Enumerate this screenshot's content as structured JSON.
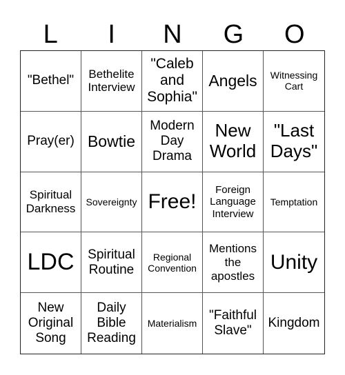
{
  "header": {
    "letters": [
      "L",
      "I",
      "N",
      "G",
      "O"
    ]
  },
  "board": {
    "rows": [
      [
        "\"Bethel\"",
        "Bethelite Interview",
        "\"Caleb and Sophia\"",
        "Angels",
        "Witnessing Cart"
      ],
      [
        "Pray(er)",
        "Bowtie",
        "Modern Day Drama",
        "New World",
        "\"Last Days\""
      ],
      [
        "Spiritual Darkness",
        "Sovereignty",
        "Free!",
        "Foreign Language Interview",
        "Temptation"
      ],
      [
        "LDC",
        "Spiritual Routine",
        "Regional Convention",
        "Mentions the apostles",
        "Unity"
      ],
      [
        "New Original Song",
        "Daily Bible Reading",
        "Materialism",
        "\"Faithful Slave\"",
        "Kingdom"
      ]
    ]
  }
}
